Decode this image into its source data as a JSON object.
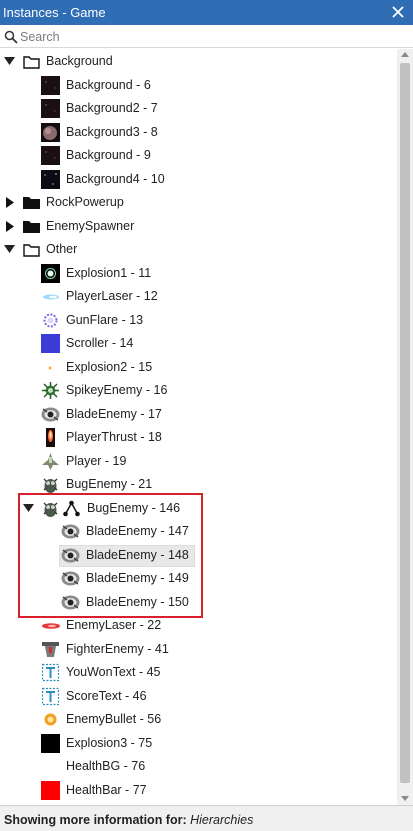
{
  "window": {
    "title": "Instances - Game",
    "close_icon": "close-icon"
  },
  "search": {
    "placeholder": "Search",
    "value": ""
  },
  "colors": {
    "titlebar": "#2f6db5",
    "highlight_border": "#d9202a",
    "scroller_swatch": "#3b3bd6",
    "healthbar_swatch": "#ff0000"
  },
  "tree": [
    {
      "label": "Background",
      "type": "folder-open",
      "expanded": true,
      "level": 0
    },
    {
      "label": "Background - 6",
      "type": "instance",
      "icon": "space-background-icon",
      "level": 1
    },
    {
      "label": "Background2 - 7",
      "type": "instance",
      "icon": "space-background-icon",
      "level": 1
    },
    {
      "label": "Background3 - 8",
      "type": "instance",
      "icon": "planet-background-icon",
      "level": 1
    },
    {
      "label": "Background - 9",
      "type": "instance",
      "icon": "space-background-icon",
      "level": 1
    },
    {
      "label": "Background4 - 10",
      "type": "instance",
      "icon": "stars-background-icon",
      "level": 1
    },
    {
      "label": "RockPowerup",
      "type": "folder-closed",
      "expanded": false,
      "level": 0
    },
    {
      "label": "EnemySpawner",
      "type": "folder-closed",
      "expanded": false,
      "level": 0
    },
    {
      "label": "Other",
      "type": "folder-open",
      "expanded": true,
      "level": 0
    },
    {
      "label": "Explosion1 - 11",
      "type": "instance",
      "icon": "explosion-icon",
      "level": 1
    },
    {
      "label": "PlayerLaser - 12",
      "type": "instance",
      "icon": "laser-icon",
      "level": 1
    },
    {
      "label": "GunFlare - 13",
      "type": "instance",
      "icon": "flare-icon",
      "level": 1
    },
    {
      "label": "Scroller - 14",
      "type": "instance",
      "icon": "scroller-swatch-icon",
      "level": 1
    },
    {
      "label": "Explosion2 - 15",
      "type": "instance",
      "icon": "spark-icon",
      "level": 1
    },
    {
      "label": "SpikeyEnemy - 16",
      "type": "instance",
      "icon": "spikey-enemy-icon",
      "level": 1
    },
    {
      "label": "BladeEnemy - 17",
      "type": "instance",
      "icon": "blade-enemy-icon",
      "level": 1
    },
    {
      "label": "PlayerThrust - 18",
      "type": "instance",
      "icon": "thrust-icon",
      "level": 1
    },
    {
      "label": "Player - 19",
      "type": "instance",
      "icon": "player-ship-icon",
      "level": 1
    },
    {
      "label": "BugEnemy - 21",
      "type": "instance",
      "icon": "bug-enemy-icon",
      "level": 1
    },
    {
      "label": "BugEnemy - 146",
      "type": "hierarchy-root",
      "icon": "bug-enemy-icon",
      "expanded": true,
      "level": 1
    },
    {
      "label": "BladeEnemy - 147",
      "type": "instance",
      "icon": "blade-enemy-icon",
      "level": 2
    },
    {
      "label": "BladeEnemy - 148",
      "type": "instance",
      "icon": "blade-enemy-icon",
      "level": 2,
      "selected": true
    },
    {
      "label": "BladeEnemy - 149",
      "type": "instance",
      "icon": "blade-enemy-icon",
      "level": 2
    },
    {
      "label": "BladeEnemy - 150",
      "type": "instance",
      "icon": "blade-enemy-icon",
      "level": 2
    },
    {
      "label": "EnemyLaser - 22",
      "type": "instance",
      "icon": "enemy-laser-icon",
      "level": 1
    },
    {
      "label": "FighterEnemy - 41",
      "type": "instance",
      "icon": "fighter-enemy-icon",
      "level": 1
    },
    {
      "label": "YouWonText - 45",
      "type": "instance",
      "icon": "text-object-icon",
      "level": 1
    },
    {
      "label": "ScoreText - 46",
      "type": "instance",
      "icon": "text-object-icon",
      "level": 1
    },
    {
      "label": "EnemyBullet - 56",
      "type": "instance",
      "icon": "bullet-icon",
      "level": 1
    },
    {
      "label": "Explosion3 - 75",
      "type": "instance",
      "icon": "black-swatch-icon",
      "level": 1
    },
    {
      "label": "HealthBG - 76",
      "type": "instance",
      "icon": "blank-icon",
      "level": 1
    },
    {
      "label": "HealthBar - 77",
      "type": "instance",
      "icon": "healthbar-swatch-icon",
      "level": 1
    }
  ],
  "status": {
    "prefix": "Showing more information for:",
    "value": "Hierarchies"
  }
}
